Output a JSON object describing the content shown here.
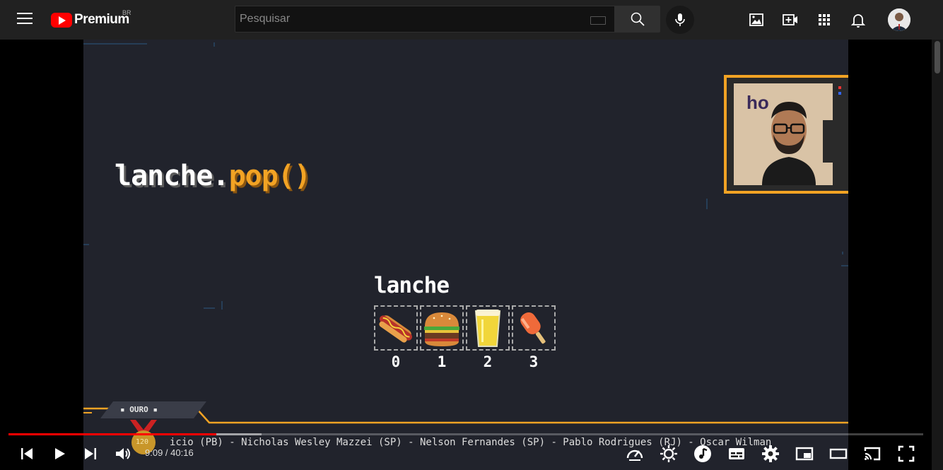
{
  "header": {
    "logo_text": "Premium",
    "logo_region": "BR",
    "search_placeholder": "Pesquisar"
  },
  "video": {
    "title_part1": "lanche.",
    "title_part2": "pop()",
    "array_label": "lanche",
    "indices": [
      "0",
      "1",
      "2",
      "3"
    ],
    "items": [
      "hot-dog",
      "hamburger",
      "beer",
      "popsicle"
    ],
    "badge_label": "▪ OURO ▪",
    "medal_number": "120",
    "ticker": "icio (PB) - Nicholas Wesley Mazzei (SP) - Nelson Fernandes (SP) - Pablo Rodrigues (RJ) - Oscar Wilman "
  },
  "player": {
    "current_time": "9:09",
    "duration": "40:16",
    "played_fraction": 0.227,
    "buffered_fraction": 0.277
  },
  "colors": {
    "accent_orange": "#f2a324",
    "brand_red": "#ff0000",
    "video_bg": "#21232c"
  }
}
